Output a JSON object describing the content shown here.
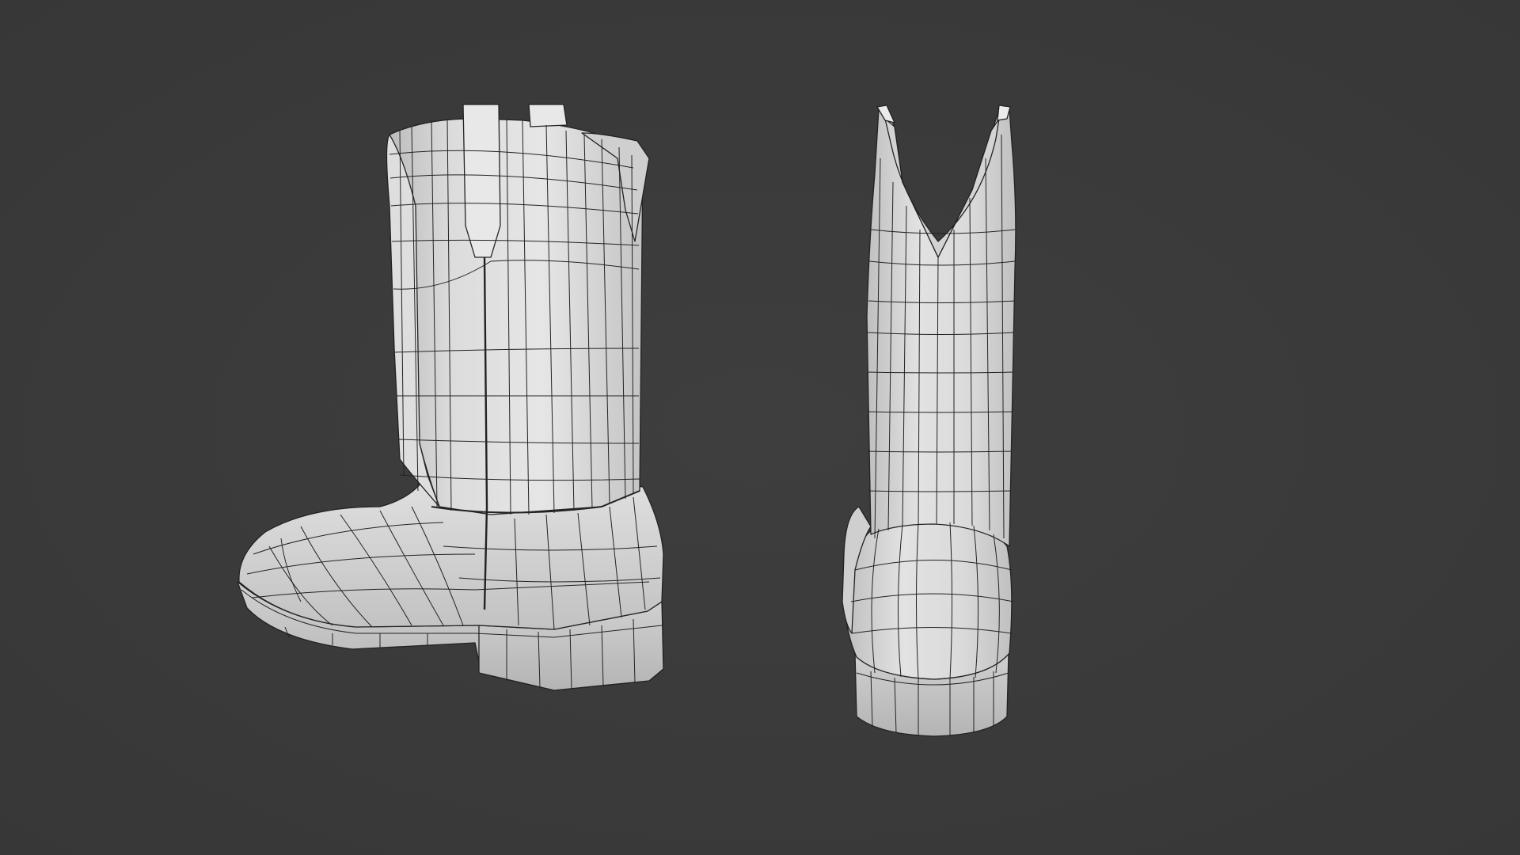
{
  "scene": {
    "background_color": "#3b3b3b",
    "mesh_color": "#d9d9d9",
    "wire_color": "#222222",
    "objects": [
      {
        "name": "boot-side-view"
      },
      {
        "name": "boot-back-view"
      }
    ]
  }
}
